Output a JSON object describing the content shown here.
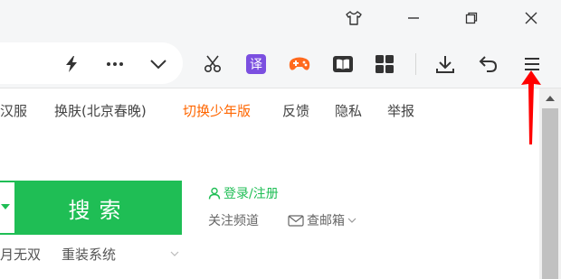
{
  "window": {
    "icons": [
      "skin-icon",
      "minimize-icon",
      "restore-icon",
      "close-icon"
    ]
  },
  "toolbar": {
    "icons": [
      "lightning-icon",
      "more-icon",
      "chevron-down-icon",
      "scissors-icon",
      "translate-icon",
      "game-icon",
      "reader-icon",
      "apps-icon",
      "download-icon",
      "undo-icon",
      "menu-icon"
    ],
    "translate_label": "译"
  },
  "nav": {
    "items": [
      {
        "label": "汉服"
      },
      {
        "label": "换肤(北京春晚)"
      },
      {
        "label": "切换少年版"
      },
      {
        "label": "反馈"
      },
      {
        "label": "隐私"
      },
      {
        "label": "举报"
      }
    ]
  },
  "search": {
    "button_label": "搜索"
  },
  "account": {
    "login_label": "登录/注册",
    "follow_channel": "关注频道",
    "mail_label": "查邮箱"
  },
  "sub_links": [
    {
      "label": "月无双"
    },
    {
      "label": "重装系统"
    }
  ],
  "colors": {
    "accent_green": "#1fbe55",
    "accent_orange": "#ff6600",
    "annotation_red": "#ff0000"
  }
}
